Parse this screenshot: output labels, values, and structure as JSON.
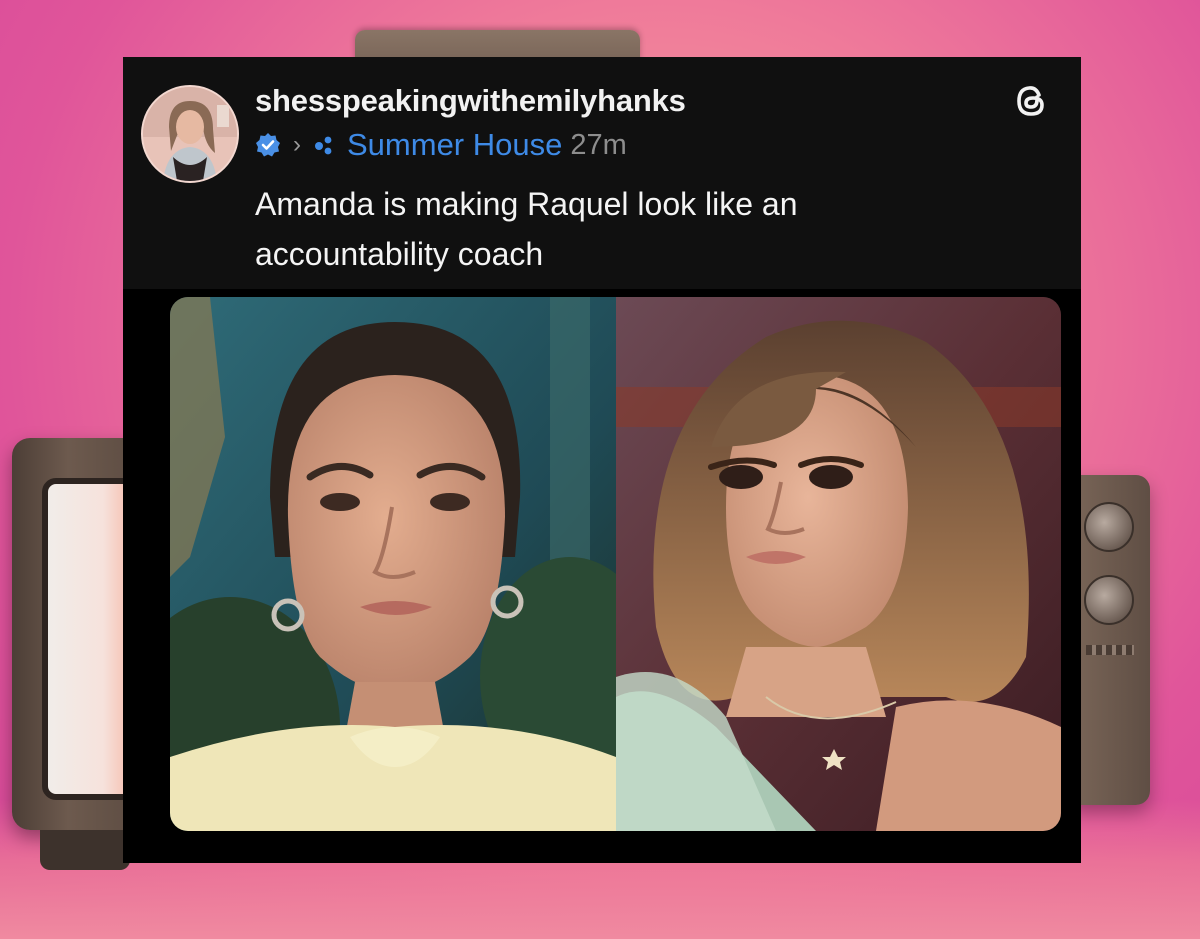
{
  "post": {
    "username": "shesspeakingwithemilyhanks",
    "community": "Summer House",
    "time": "27m",
    "text": "Amanda is making Raquel look like an accountability coach"
  },
  "icons": {
    "verified": "verified-badge-icon",
    "separator": "chevron-right-icon",
    "community": "community-dots-icon",
    "app": "threads-logo-icon"
  },
  "colors": {
    "background": "#e6609a",
    "card": "#000000",
    "header": "#101010",
    "username": "#f2f2f2",
    "community_link": "#3e8ae6",
    "timestamp": "#8d8d8d"
  }
}
